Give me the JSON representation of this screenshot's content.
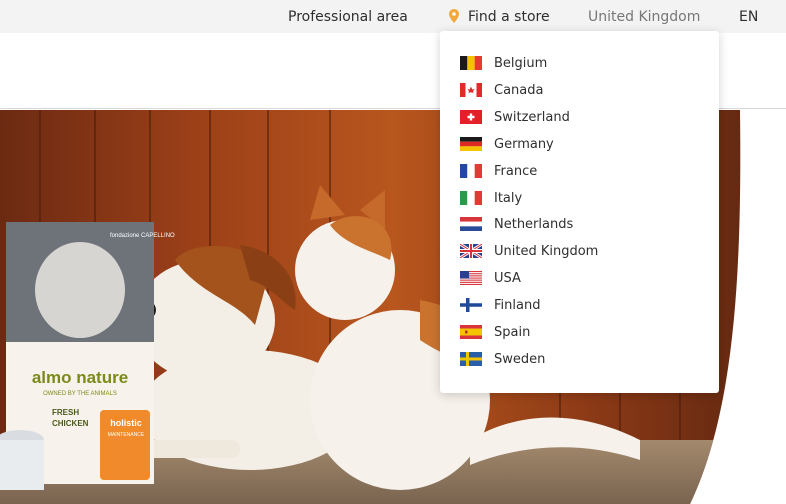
{
  "topbar": {
    "professional_area": "Professional area",
    "find_store": "Find a store",
    "country": "United Kingdom",
    "language": "EN",
    "pin_color": "#f2a93b"
  },
  "dropdown": {
    "countries": [
      {
        "label": "Belgium",
        "flag": "belgium-flag-icon"
      },
      {
        "label": "Canada",
        "flag": "canada-flag-icon"
      },
      {
        "label": "Switzerland",
        "flag": "switzerland-flag-icon"
      },
      {
        "label": "Germany",
        "flag": "germany-flag-icon"
      },
      {
        "label": "France",
        "flag": "france-flag-icon"
      },
      {
        "label": "Italy",
        "flag": "italy-flag-icon"
      },
      {
        "label": "Netherlands",
        "flag": "netherlands-flag-icon"
      },
      {
        "label": "United Kingdom",
        "flag": "uk-flag-icon"
      },
      {
        "label": "USA",
        "flag": "usa-flag-icon"
      },
      {
        "label": "Finland",
        "flag": "finland-flag-icon"
      },
      {
        "label": "Spain",
        "flag": "spain-flag-icon"
      },
      {
        "label": "Sweden",
        "flag": "sweden-flag-icon"
      }
    ]
  },
  "hero": {
    "brand": "almo nature",
    "brand_tagline": "OWNED BY THE ANIMALS",
    "bag_brand": "fondazione CAPELLINO",
    "bag_flavour_1": "FRESH",
    "bag_flavour_2": "CHICKEN",
    "bag_badge_1": "holistic",
    "bag_badge_2": "MAINTENANCE"
  }
}
